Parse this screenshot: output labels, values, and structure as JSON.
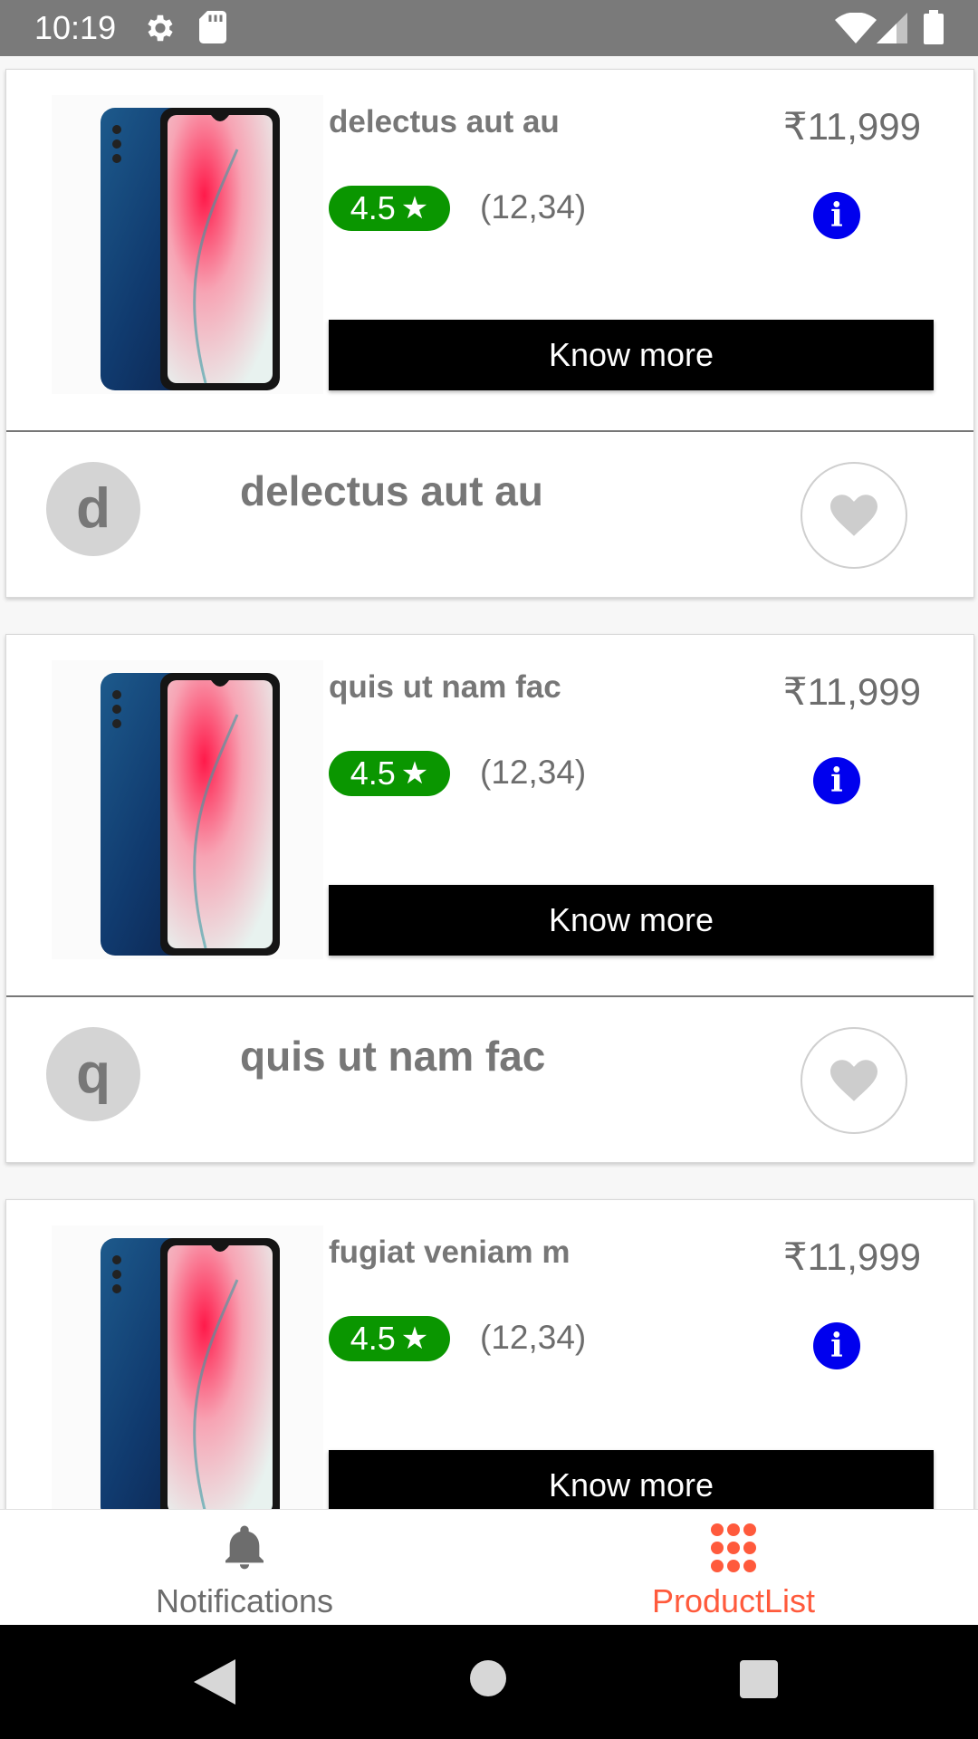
{
  "status_bar": {
    "time": "10:19",
    "icons": [
      "gear-icon",
      "sd-card-icon",
      "wifi-icon",
      "signal-icon",
      "battery-icon"
    ]
  },
  "products": [
    {
      "name": "delectus aut au",
      "price": "₹11,999",
      "rating": "4.5",
      "review_count": "(12,34)",
      "button_label": "Know more",
      "avatar_letter": "d",
      "footer_name": "delectus aut au"
    },
    {
      "name": "quis ut nam fac",
      "price": "₹11,999",
      "rating": "4.5",
      "review_count": "(12,34)",
      "button_label": "Know more",
      "avatar_letter": "q",
      "footer_name": "quis ut nam fac"
    },
    {
      "name": "fugiat veniam m",
      "price": "₹11,999",
      "rating": "4.5",
      "review_count": "(12,34)",
      "button_label": "Know more"
    }
  ],
  "info_glyph": "i",
  "tabs": [
    {
      "label": "Notifications",
      "icon": "bell-icon",
      "active": false
    },
    {
      "label": "ProductList",
      "icon": "grid-icon",
      "active": true
    }
  ],
  "colors": {
    "status_bar": "#7a7a7a",
    "rating_badge": "#0a9600",
    "info_button": "#0000ee",
    "active_tab": "#ff5a3c",
    "inactive_tab": "#6d6d6d"
  }
}
